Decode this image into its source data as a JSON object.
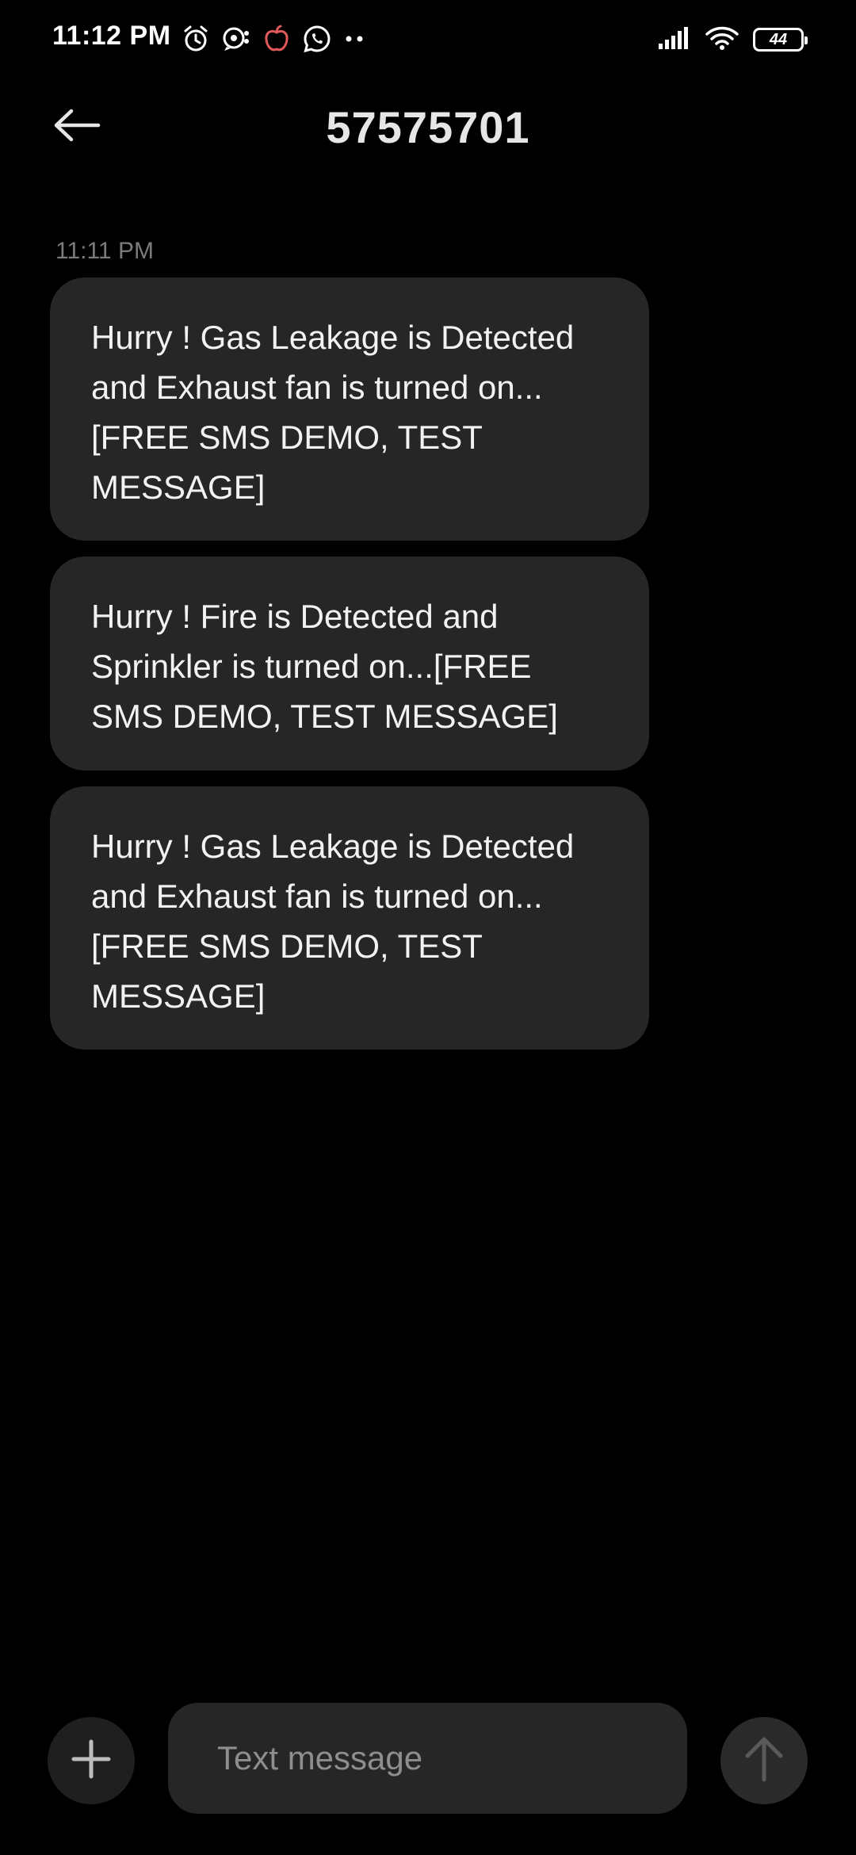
{
  "status_bar": {
    "time": "11:12 PM",
    "battery_level": "44",
    "icons_left": [
      "alarm-icon",
      "chat-bubble-icon",
      "apple-icon",
      "whatsapp-icon",
      "more-dots-icon"
    ],
    "icons_right": [
      "signal-icon",
      "wifi-icon",
      "battery-icon"
    ]
  },
  "header": {
    "title": "57575701",
    "back_icon": "arrow-left-icon"
  },
  "thread": {
    "timestamp": "11:11 PM",
    "messages": [
      {
        "text": "Hurry ! Gas Leakage  is Detected and Exhaust fan is turned on...[FREE SMS DEMO, TEST MESSAGE]"
      },
      {
        "text": "Hurry ! Fire is Detected and Sprinkler is turned on...[FREE SMS DEMO, TEST MESSAGE]"
      },
      {
        "text": "Hurry ! Gas Leakage  is Detected and Exhaust fan is turned on...[FREE SMS DEMO, TEST MESSAGE]"
      }
    ]
  },
  "composer": {
    "placeholder": "Text message",
    "value": "",
    "add_icon": "plus-icon",
    "send_icon": "arrow-up-icon"
  },
  "colors": {
    "background": "#000000",
    "bubble": "#262626",
    "timestamp_text": "#7b7b7b",
    "placeholder_text": "#8e8e8e",
    "apple_icon_accent": "#e05a5a"
  }
}
